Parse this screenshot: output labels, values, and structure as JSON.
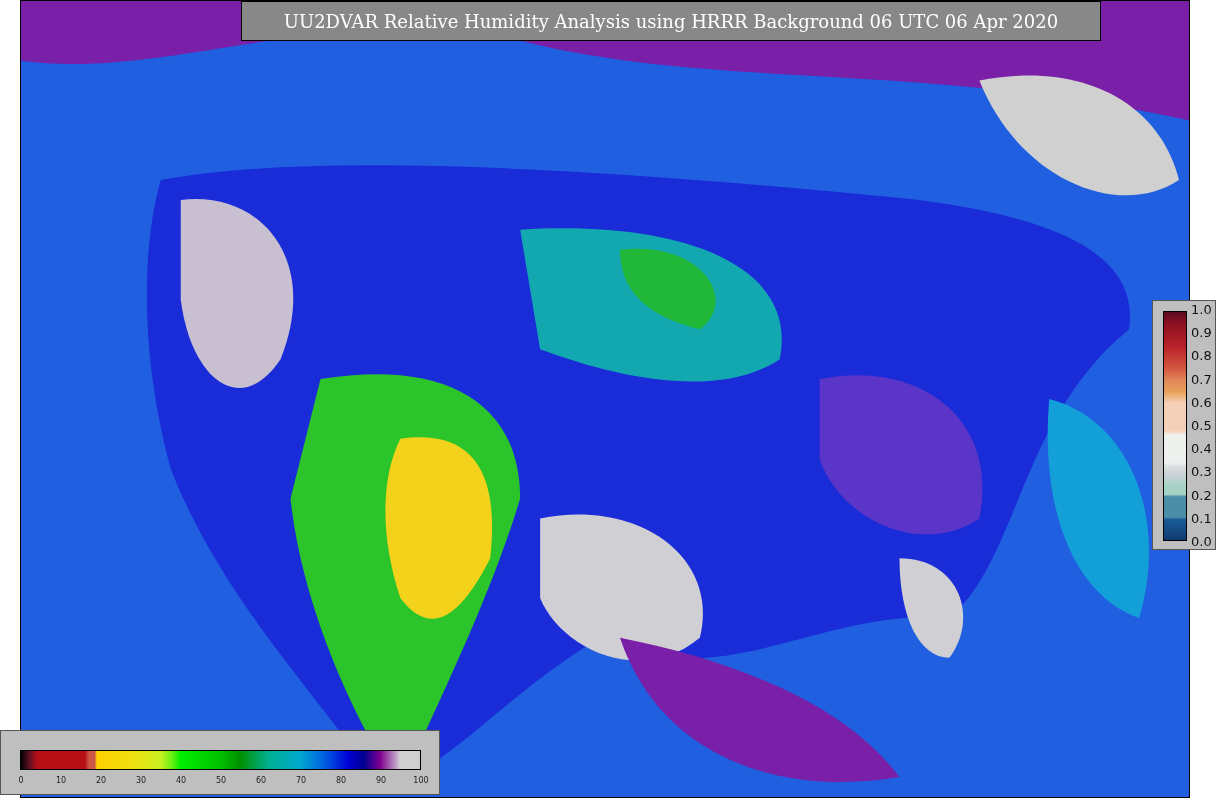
{
  "title": "UU2DVAR Relative Humidity Analysis using HRRR Background 06 UTC 06 Apr 2020",
  "humidity_colorbar": {
    "ticks": [
      "0",
      "10",
      "20",
      "30",
      "40",
      "50",
      "60",
      "70",
      "80",
      "90",
      "100"
    ]
  },
  "ratio_colorbar": {
    "ticks": [
      "1.0",
      "0.9",
      "0.8",
      "0.7",
      "0.6",
      "0.5",
      "0.4",
      "0.3",
      "0.2",
      "0.1",
      "0.0"
    ]
  }
}
